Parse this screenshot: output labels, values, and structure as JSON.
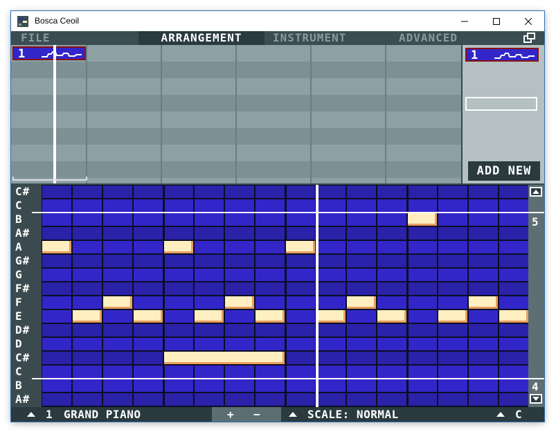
{
  "window": {
    "title": "Bosca Ceoil",
    "buttons": {
      "minimize": "minimize",
      "maximize": "maximize",
      "close": "close"
    }
  },
  "menu": {
    "items": [
      "FILE",
      "ARRANGEMENT",
      "INSTRUMENT",
      "ADVANCED"
    ],
    "active": "ARRANGEMENT"
  },
  "arrangement": {
    "pattern_number": "1"
  },
  "side_panel": {
    "pattern_number": "1",
    "add_new_label": "ADD NEW"
  },
  "piano_roll": {
    "note_labels": [
      "C#",
      "C",
      "B",
      "A#",
      "A",
      "G#",
      "G",
      "F#",
      "F",
      "E",
      "D#",
      "D",
      "C#",
      "C",
      "B",
      "A#"
    ],
    "octave_upper": "5",
    "octave_lower": "4",
    "notes": [
      {
        "note": "A",
        "step": 0,
        "length": 1
      },
      {
        "note": "E",
        "step": 1,
        "length": 1
      },
      {
        "note": "F",
        "step": 2,
        "length": 1
      },
      {
        "note": "E",
        "step": 3,
        "length": 1
      },
      {
        "note": "A",
        "step": 4,
        "length": 1
      },
      {
        "note": "E",
        "step": 5,
        "length": 1
      },
      {
        "note": "F",
        "step": 6,
        "length": 1
      },
      {
        "note": "E",
        "step": 7,
        "length": 1
      },
      {
        "note": "C#",
        "step": 4,
        "length": 4
      },
      {
        "note": "A",
        "step": 8,
        "length": 1
      },
      {
        "note": "E",
        "step": 9,
        "length": 1
      },
      {
        "note": "F",
        "step": 10,
        "length": 1
      },
      {
        "note": "E",
        "step": 11,
        "length": 1
      },
      {
        "note": "B",
        "step": 12,
        "length": 1
      },
      {
        "note": "E",
        "step": 13,
        "length": 1
      },
      {
        "note": "F",
        "step": 14,
        "length": 1
      },
      {
        "note": "E",
        "step": 15,
        "length": 1
      }
    ]
  },
  "status": {
    "instrument_number": "1",
    "instrument_name": "Grand Piano",
    "plus": "+",
    "minus": "−",
    "scale": "Scale: Normal",
    "key": "C"
  },
  "colors": {
    "cell": "#3326c9",
    "cell_dark": "#2a22a8",
    "note": "#ffefc0"
  }
}
